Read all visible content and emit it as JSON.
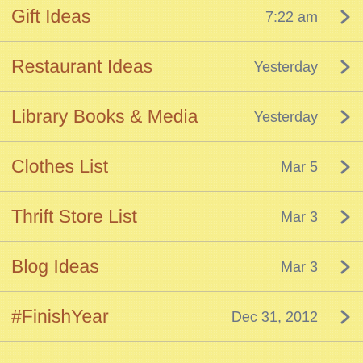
{
  "notes": [
    {
      "title": "Gift Ideas",
      "date": "7:22 am"
    },
    {
      "title": "Restaurant Ideas",
      "date": "Yesterday"
    },
    {
      "title": "Library Books & Media",
      "date": "Yesterday"
    },
    {
      "title": "Clothes List",
      "date": "Mar 5"
    },
    {
      "title": "Thrift Store List",
      "date": "Mar 3"
    },
    {
      "title": "Blog Ideas",
      "date": "Mar 3"
    },
    {
      "title": "#FinishYear",
      "date": "Dec 31, 2012"
    }
  ],
  "icons": {
    "disclosure": "chevron-right-icon"
  },
  "colors": {
    "background": "#f7ef8e",
    "title_text": "#a3552f",
    "date_text": "#6a7486",
    "separator": "#c9c39b",
    "chevron": "#727a88"
  }
}
